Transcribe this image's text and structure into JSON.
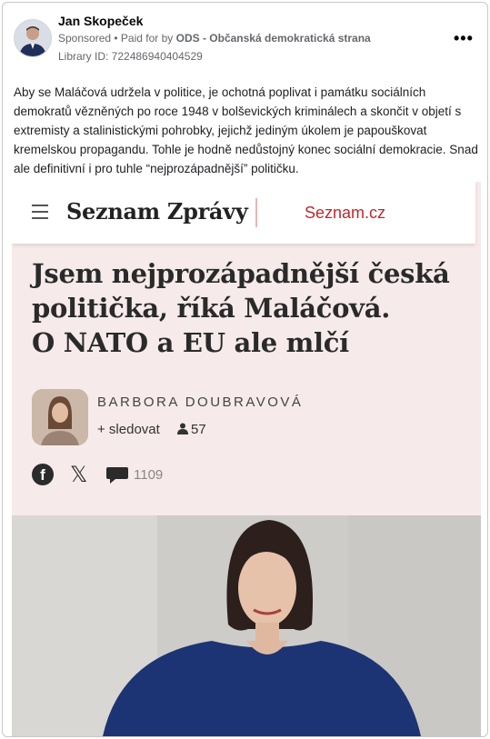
{
  "post": {
    "author": "Jan Skopeček",
    "sponsored": "Sponsored",
    "paid_prefix": " • Paid for by ",
    "payer": "ODS - Občanská demokratická strana",
    "library_id": "Library ID: 722486940404529",
    "more_label": "•••",
    "text": "Aby se Maláčová udržela v politice, je ochotná poplivat i památku sociálních demokratů vězněných po roce 1948 v bolševických kriminálech a skončit v objetí s extremisty a stalinistickými pohrobky, jejichž jediným úkolem je papouškovat kremelskou propagandu. Tohle je hodně nedůstojný konec sociální demokracie. Snad ale definitivní i pro tuhle “nejprozápadnější” političku."
  },
  "article": {
    "brand": "Seznam Zprávy",
    "brand2": "Seznam.cz",
    "headline_lines": [
      "Jsem nejprozápadnější česká",
      "politička, říká Maláčová.",
      "O NATO a EU ale mlčí"
    ],
    "author_name": "BARBORA DOUBRAVOVÁ",
    "follow_label": "+ sledovat",
    "followers": "57",
    "comments": "1109"
  },
  "colors": {
    "accent_red": "#c0282d",
    "article_bg": "#f6eaea"
  }
}
